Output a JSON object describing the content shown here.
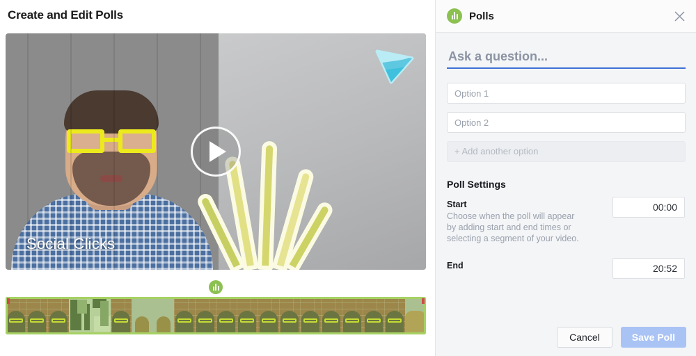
{
  "editor": {
    "page_title": "Create and Edit Polls",
    "video": {
      "caption": "Social Clicks",
      "play_icon": "play-icon",
      "watermark_icon": "play-triangle-logo-icon"
    },
    "timeline": {
      "poll_marker_icon": "poll-bars-icon",
      "selection_color": "#a6d164"
    }
  },
  "panel": {
    "icon": "poll-bars-icon",
    "title": "Polls",
    "close_icon": "close-icon",
    "question": {
      "value": "",
      "placeholder": "Ask a question...",
      "underline_color": "#3c6fd6"
    },
    "options": [
      {
        "value": "",
        "placeholder": "Option 1"
      },
      {
        "value": "",
        "placeholder": "Option 2"
      }
    ],
    "add_option_label": "+ Add another option",
    "settings_title": "Poll Settings",
    "start": {
      "label": "Start",
      "description": "Choose when the poll will appear by adding start and end times or selecting a segment of your video.",
      "value": "00:00"
    },
    "end": {
      "label": "End",
      "value": "20:52"
    },
    "footer": {
      "cancel_label": "Cancel",
      "save_label": "Save Poll",
      "save_color": "#a9c3f5"
    }
  }
}
